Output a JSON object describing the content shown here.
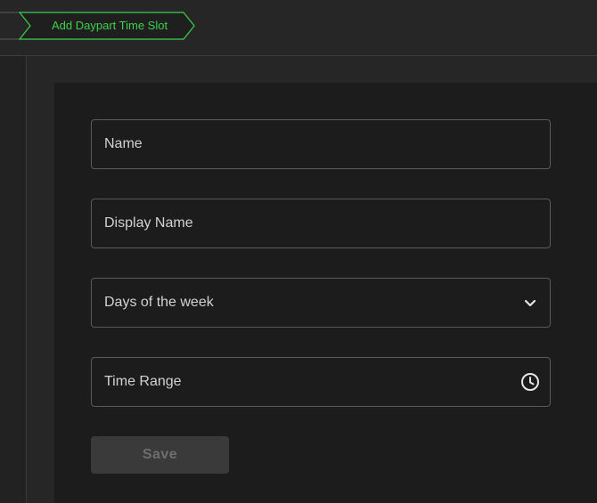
{
  "breadcrumb": {
    "current": "Add Daypart Time Slot",
    "accent_color": "#3bd14a"
  },
  "form": {
    "name_label": "Name",
    "display_name_label": "Display Name",
    "days_label": "Days of the week",
    "days_icon": "chevron-down-icon",
    "time_range_label": "Time Range",
    "time_icon": "clock-icon",
    "save_label": "Save"
  }
}
